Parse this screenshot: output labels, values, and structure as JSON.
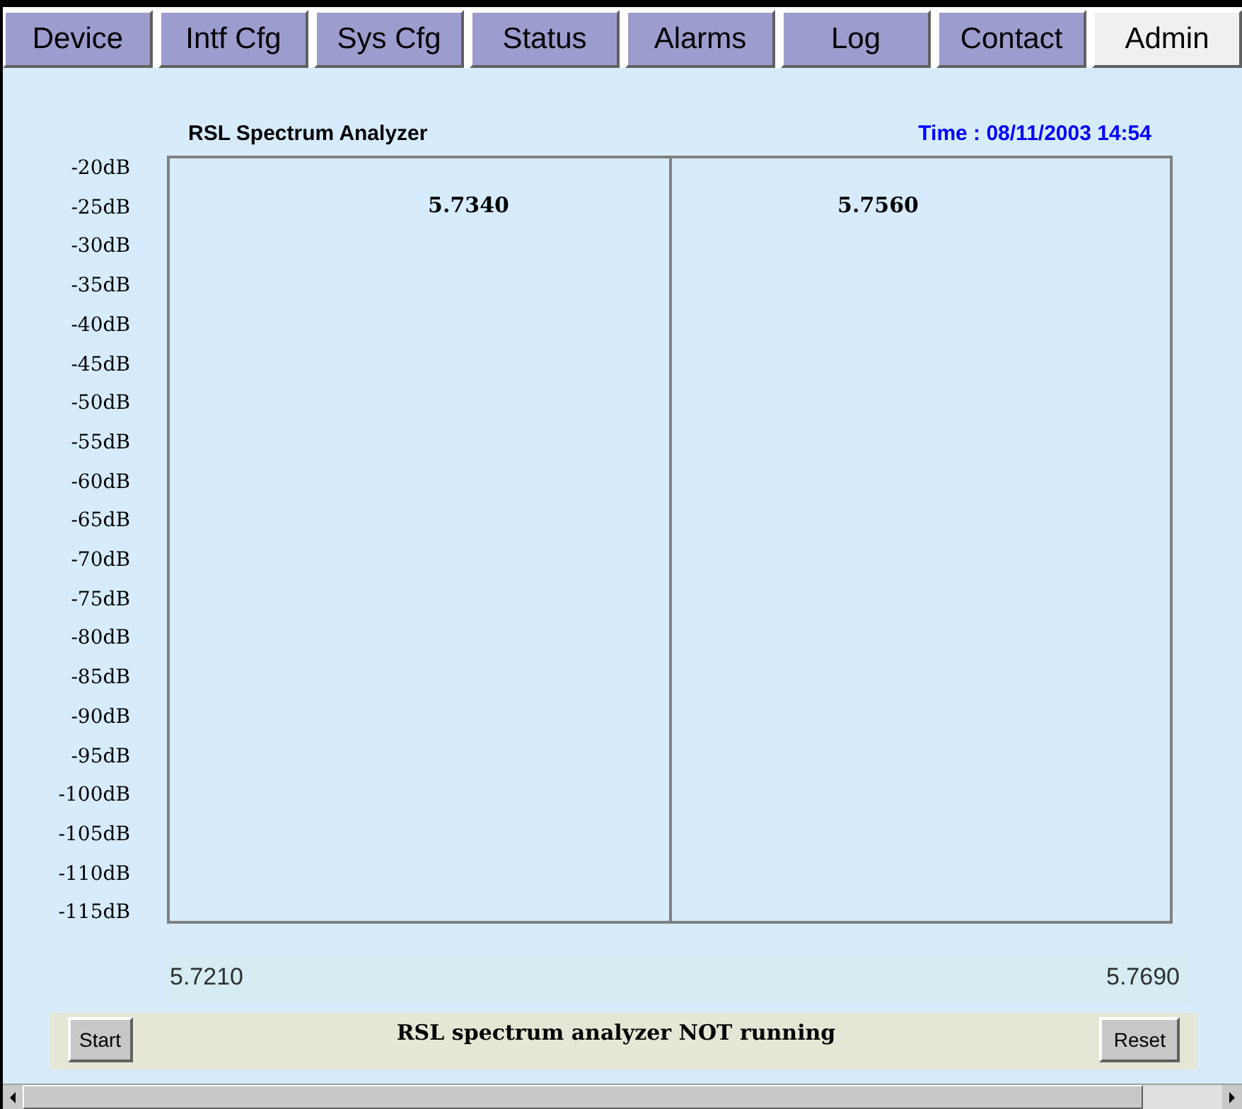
{
  "tabs": [
    {
      "label": "Device",
      "selected": false
    },
    {
      "label": "Intf Cfg",
      "selected": false
    },
    {
      "label": "Sys Cfg",
      "selected": false
    },
    {
      "label": "Status",
      "selected": false
    },
    {
      "label": "Alarms",
      "selected": false
    },
    {
      "label": "Log",
      "selected": false
    },
    {
      "label": "Contact",
      "selected": false
    },
    {
      "label": "Admin",
      "selected": true
    }
  ],
  "analyzer": {
    "title": "RSL Spectrum Analyzer",
    "time": "Time : 08/11/2003 14:54",
    "y_labels": [
      "-20dB",
      "-25dB",
      "-30dB",
      "-35dB",
      "-40dB",
      "-45dB",
      "-50dB",
      "-55dB",
      "-60dB",
      "-65dB",
      "-70dB",
      "-75dB",
      "-80dB",
      "-85dB",
      "-90dB",
      "-95dB",
      "-100dB",
      "-105dB",
      "-110dB",
      "-115dB"
    ],
    "marker_labels": [
      "5.7340",
      "5.7560"
    ],
    "x_start": "5.7210",
    "x_end": "5.7690"
  },
  "controls": {
    "start": "Start",
    "status": "RSL spectrum analyzer NOT running",
    "reset": "Reset"
  }
}
